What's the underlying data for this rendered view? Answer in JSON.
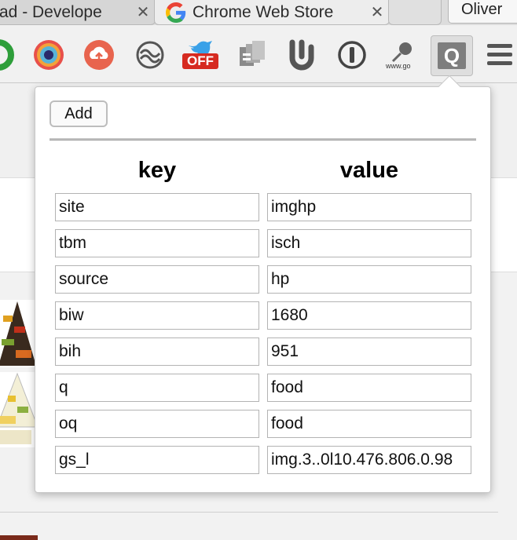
{
  "browser": {
    "tabs": [
      {
        "title": "ad - Develope",
        "close": "✕"
      },
      {
        "title": "Chrome Web Store",
        "close": "✕"
      }
    ],
    "profile_name": "Oliver",
    "extensions": [
      {
        "name": "green-ring-extension-icon"
      },
      {
        "name": "eye-extension-icon"
      },
      {
        "name": "cloud-upload-extension-icon"
      },
      {
        "name": "wave-circle-extension-icon"
      },
      {
        "name": "bird-extension-icon",
        "badge": "OFF"
      },
      {
        "name": "copy-pages-extension-icon"
      },
      {
        "name": "u-letter-extension-icon"
      },
      {
        "name": "info-circle-extension-icon"
      },
      {
        "name": "pushpin-extension-icon",
        "caption": "www.go"
      },
      {
        "name": "q-extension-icon",
        "letter": "Q"
      }
    ]
  },
  "popup": {
    "add_label": "Add",
    "headers": {
      "key": "key",
      "value": "value"
    },
    "rows": [
      {
        "key": "site",
        "value": "imghp"
      },
      {
        "key": "tbm",
        "value": "isch"
      },
      {
        "key": "source",
        "value": "hp"
      },
      {
        "key": "biw",
        "value": "1680"
      },
      {
        "key": "bih",
        "value": "951"
      },
      {
        "key": "q",
        "value": "food"
      },
      {
        "key": "oq",
        "value": "food"
      },
      {
        "key": "gs_l",
        "value": "img.3..0l10.476.806.0.98"
      }
    ]
  },
  "colors": {
    "off_badge": "#d62a20",
    "active_extension": "#7e7e7e"
  }
}
